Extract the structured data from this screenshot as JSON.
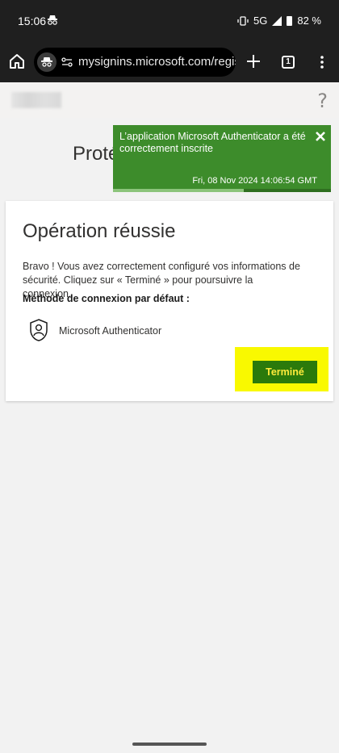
{
  "status_bar": {
    "time": "15:06",
    "network": "5G",
    "battery": "82 %"
  },
  "browser": {
    "url": "mysignins.microsoft.com/regis",
    "tab_count": "1"
  },
  "page": {
    "heading_partial": "Proté",
    "help": "?"
  },
  "toast": {
    "message": "L’application Microsoft Authenticator a été correctement inscrite",
    "timestamp": "Fri, 08 Nov 2024 14:06:54 GMT",
    "progress": 0.6,
    "close_icon": "close-x",
    "color": "#3d8c2b"
  },
  "card": {
    "title": "Opération réussie",
    "description": "Bravo ! Vous avez correctement configuré vos informations de sécurité. Cliquez sur « Terminé » pour poursuivre la connexion.",
    "method_title": "Méthode de connexion par défaut :",
    "method_name": "Microsoft Authenticator",
    "method_icon": "authenticator-lock-icon",
    "done_label": "Terminé",
    "done_color": "#2b7a0b",
    "highlight_color": "#f9f900"
  }
}
